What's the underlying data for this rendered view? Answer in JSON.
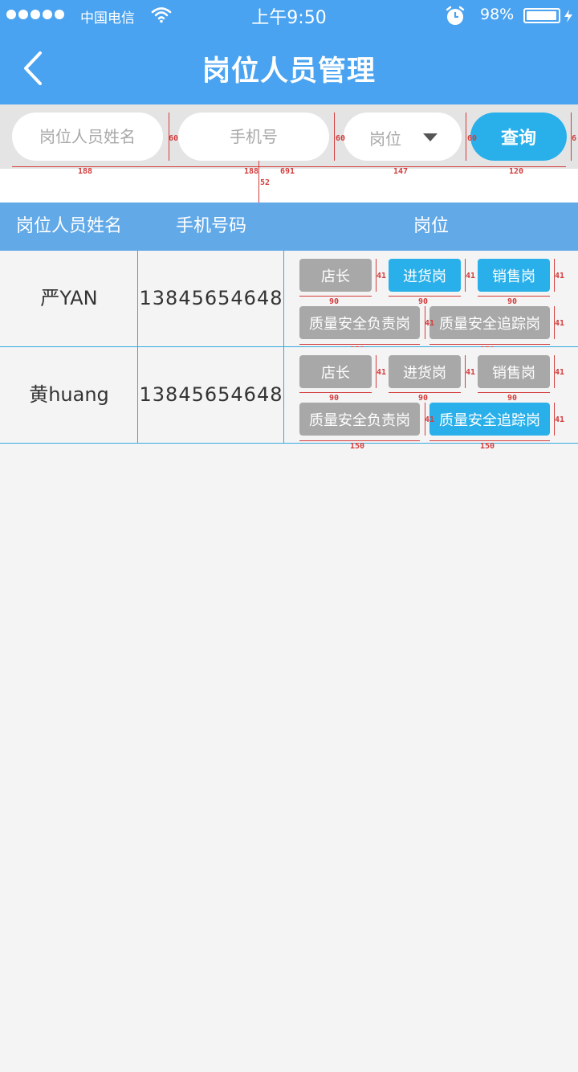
{
  "status_bar": {
    "carrier": "中国电信",
    "time": "上午9:50",
    "battery_percent": "98%",
    "battery_level": 0.98,
    "signal_dots": 5
  },
  "header": {
    "title": "岗位人员管理",
    "background_color": "#4aa3f0"
  },
  "filters": {
    "name_placeholder": "岗位人员姓名",
    "phone_placeholder": "手机号",
    "post_select_label": "岗位",
    "query_button": "查询",
    "accent_color": "#29b0ea"
  },
  "table": {
    "columns": [
      "岗位人员姓名",
      "手机号码",
      "岗位"
    ],
    "rows": [
      {
        "name": "严YAN",
        "phone": "13845654648",
        "tags": [
          {
            "label": "店长",
            "active": false
          },
          {
            "label": "进货岗",
            "active": true
          },
          {
            "label": "销售岗",
            "active": true
          },
          {
            "label": "质量安全负责岗",
            "active": false
          },
          {
            "label": "质量安全追踪岗",
            "active": false
          }
        ]
      },
      {
        "name": "黄huang",
        "phone": "13845654648",
        "tags": [
          {
            "label": "店长",
            "active": false
          },
          {
            "label": "进货岗",
            "active": false
          },
          {
            "label": "销售岗",
            "active": false
          },
          {
            "label": "质量安全负责岗",
            "active": false
          },
          {
            "label": "质量安全追踪岗",
            "active": true
          }
        ]
      }
    ]
  },
  "annotations": {
    "filter_height": "60",
    "name_width": "188",
    "phone_width": "188",
    "phone_extra": "691",
    "post_width": "147",
    "query_width": "120",
    "spacer_height": "52",
    "tag_height": "41",
    "small_tag_width": "90",
    "wide_tag_width": "150",
    "edge_label": "6"
  }
}
